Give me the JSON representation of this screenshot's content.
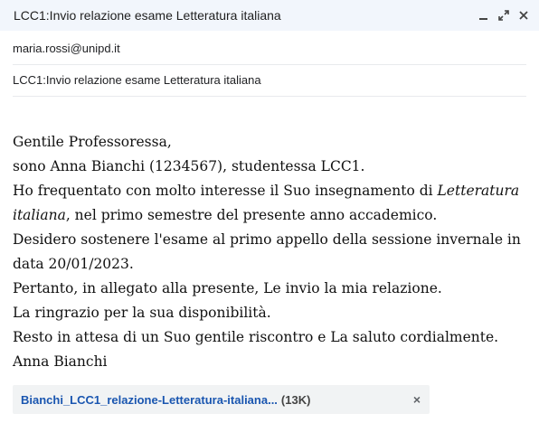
{
  "window": {
    "title": "LCC1:Invio relazione esame Letteratura italiana"
  },
  "controls": {
    "minimize": "minimize-icon",
    "popout": "expand-icon",
    "close": "close-icon"
  },
  "recipient": "maria.rossi@unipd.it",
  "subject": "LCC1:Invio relazione esame Letteratura italiana",
  "body": {
    "greeting": "Gentile Professoressa,",
    "line1": "sono Anna Bianchi (1234567), studentessa LCC1.",
    "line2_a": "Ho frequentato con molto interesse il Suo insegnamento di ",
    "line2_italic": "Letteratura italiana",
    "line2_b": ", nel primo semestre del presente anno accademico.",
    "line3": "Desidero sostenere l'esame al primo appello della sessione invernale in data 20/01/2023.",
    "line4": "Pertanto, in allegato alla presente, Le invio la mia relazione.",
    "line5": "La ringrazio per la sua disponibilità.",
    "line6": "Resto in attesa di un Suo gentile riscontro e La saluto cordialmente.",
    "signature": "Anna Bianchi"
  },
  "attachment": {
    "name": "Bianchi_LCC1_relazione-Letteratura-italiana...",
    "size": "(13K)",
    "remove": "×"
  }
}
